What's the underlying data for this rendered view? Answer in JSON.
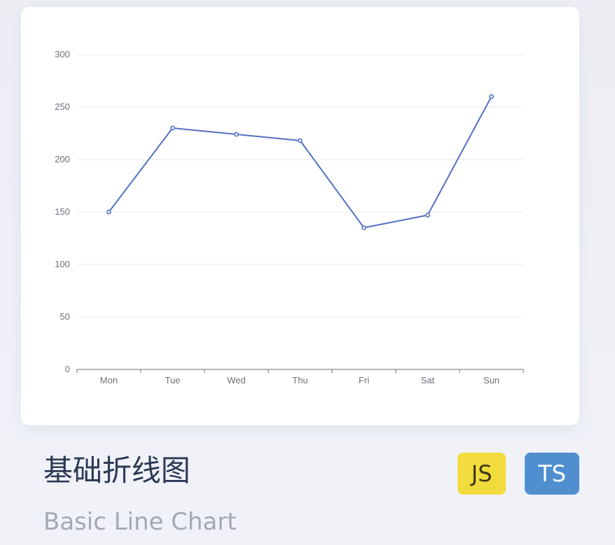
{
  "colors": {
    "line": "#5470c6",
    "grid": "#e8eaee",
    "axis": "#6e7079",
    "js_badge": "#f2dc3d",
    "ts_badge": "#4f8fd0"
  },
  "title": {
    "zh": "基础折线图",
    "en": "Basic Line Chart"
  },
  "badges": {
    "js": "JS",
    "ts": "TS"
  },
  "chart_data": {
    "type": "line",
    "categories": [
      "Mon",
      "Tue",
      "Wed",
      "Thu",
      "Fri",
      "Sat",
      "Sun"
    ],
    "values": [
      150,
      230,
      224,
      218,
      135,
      147,
      260
    ],
    "ylim": [
      0,
      300
    ],
    "yticks": [
      0,
      50,
      100,
      150,
      200,
      250,
      300
    ],
    "grid": true,
    "markers": "hollow-circle"
  }
}
